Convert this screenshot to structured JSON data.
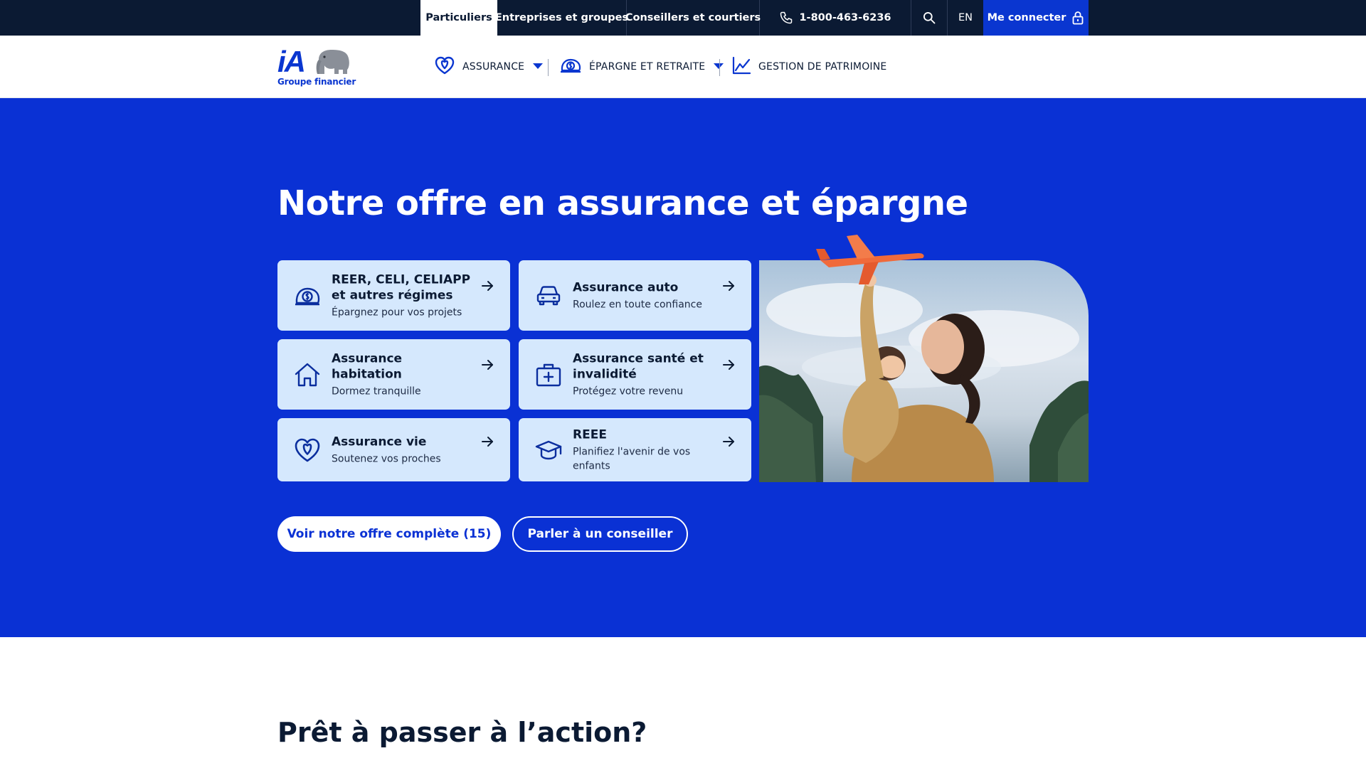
{
  "topbar": {
    "tabs": [
      "Particuliers",
      "Entreprises et groupes",
      "Conseillers et courtiers"
    ],
    "phone": "1-800-463-6236",
    "search_icon": "search-icon",
    "language": "EN",
    "login": "Me connecter",
    "login_icon": "lock-icon"
  },
  "logo": {
    "mark": "iA",
    "subtitle": "Groupe financier"
  },
  "nav": {
    "items": [
      {
        "label": "ASSURANCE",
        "icon": "heart-icon",
        "has_dropdown": true
      },
      {
        "label": "ÉPARGNE ET RETRAITE",
        "icon": "piggy-bank-icon",
        "has_dropdown": true
      },
      {
        "label": "GESTION DE PATRIMOINE",
        "icon": "chart-line-icon",
        "has_dropdown": false
      }
    ]
  },
  "hero": {
    "title": "Notre offre en assurance et épargne",
    "cards": [
      {
        "title": "REER, CELI, CELIAPP et autres régimes",
        "subtitle": "Épargnez pour vos projets",
        "icon": "piggy-bank-icon"
      },
      {
        "title": "Assurance auto",
        "subtitle": "Roulez en toute confiance",
        "icon": "car-icon"
      },
      {
        "title": "Assurance habitation",
        "subtitle": "Dormez tranquille",
        "icon": "house-icon"
      },
      {
        "title": "Assurance santé et invalidité",
        "subtitle": "Protégez votre revenu",
        "icon": "medical-kit-icon"
      },
      {
        "title": "Assurance vie",
        "subtitle": "Soutenez vos proches",
        "icon": "heart-icon"
      },
      {
        "title": "REEE",
        "subtitle": "Planifiez l'avenir de vos enfants",
        "icon": "graduation-cap-icon"
      }
    ],
    "primary_button": "Voir notre offre complète (15)",
    "secondary_button": "Parler à un conseiller"
  },
  "section2": {
    "title": "Prêt à passer à l’action?"
  },
  "colors": {
    "topbar_bg": "#0b1a33",
    "brand_blue": "#0a31d4",
    "card_bg": "#d5e8fd",
    "login_bg": "#0a36d0"
  }
}
